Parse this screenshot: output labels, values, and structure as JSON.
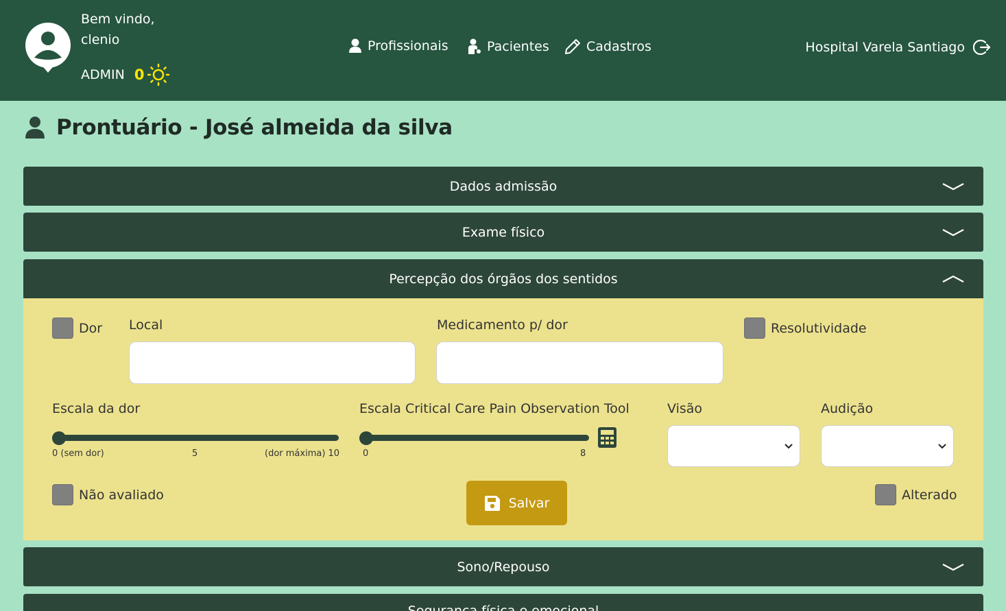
{
  "header": {
    "welcome_line1": "Bem vindo,",
    "welcome_line2": "clenio",
    "role": "ADMIN",
    "count": "0",
    "nav": [
      {
        "label": "Profissionais",
        "icon": "user-icon"
      },
      {
        "label": "Pacientes",
        "icon": "patient-icon"
      },
      {
        "label": "Cadastros",
        "icon": "pencil-icon"
      }
    ],
    "hospital": "Hospital Varela Santiago"
  },
  "page": {
    "title": "Prontuário - José almeida da silva"
  },
  "sections": [
    {
      "label": "Dados admissão",
      "expanded": false
    },
    {
      "label": "Exame físico",
      "expanded": false
    },
    {
      "label": "Percepção dos órgãos dos sentidos",
      "expanded": true
    },
    {
      "label": "Sono/Repouso",
      "expanded": false
    },
    {
      "label": "Segurança física e emocional",
      "expanded": false
    }
  ],
  "form": {
    "dor_label": "Dor",
    "local_label": "Local",
    "local_value": "",
    "medicamento_label": "Medicamento p/ dor",
    "medicamento_value": "",
    "resolutividade_label": "Resolutividade",
    "escala_dor_label": "Escala da dor",
    "escala_dor_value": 0,
    "escala_dor_ticks": [
      "0 (sem dor)",
      "5",
      "(dor máxima) 10"
    ],
    "cpot_label": "Escala Critical Care Pain Observation Tool",
    "cpot_value": 0,
    "cpot_ticks": [
      "0",
      "8"
    ],
    "visao_label": "Visão",
    "visao_value": "",
    "audicao_label": "Audição",
    "audicao_value": "",
    "nao_avaliado_label": "Não avaliado",
    "alterado_label": "Alterado",
    "save_label": "Salvar"
  },
  "colors": {
    "header_bg": "#265540",
    "page_bg": "#a8e2c4",
    "accordion_bg": "#2d463a",
    "panel_bg": "#ece28e",
    "save_button": "#c49a12",
    "count_accent": "#ffe600"
  }
}
